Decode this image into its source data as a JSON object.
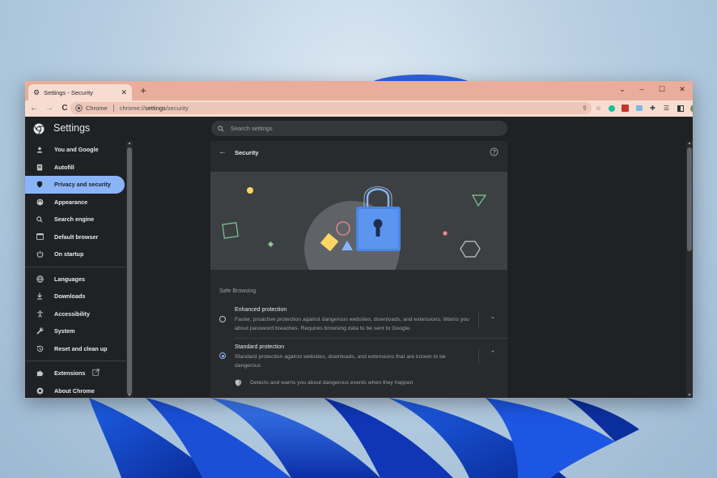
{
  "window": {
    "tab_title": "Settings - Security",
    "tab_close": "✕",
    "new_tab": "+",
    "controls": {
      "chevron": "⌄",
      "minimize": "–",
      "maximize": "☐",
      "close": "✕"
    }
  },
  "toolbar": {
    "back": "←",
    "forward": "→",
    "reload": "C",
    "site_name": "Chrome",
    "url_prefix": "chrome://",
    "url_host": "settings",
    "url_path": "/security"
  },
  "header": {
    "title": "Settings",
    "search_placeholder": "Search settings"
  },
  "sidebar": {
    "items": [
      {
        "label": "You and Google",
        "icon": "person-icon"
      },
      {
        "label": "Autofill",
        "icon": "clipboard-icon"
      },
      {
        "label": "Privacy and security",
        "icon": "shield-icon",
        "active": true
      },
      {
        "label": "Appearance",
        "icon": "palette-icon"
      },
      {
        "label": "Search engine",
        "icon": "search-icon"
      },
      {
        "label": "Default browser",
        "icon": "browser-icon"
      },
      {
        "label": "On startup",
        "icon": "power-icon"
      },
      {
        "label": "Languages",
        "icon": "globe-icon"
      },
      {
        "label": "Downloads",
        "icon": "download-icon"
      },
      {
        "label": "Accessibility",
        "icon": "accessibility-icon"
      },
      {
        "label": "System",
        "icon": "wrench-icon"
      },
      {
        "label": "Reset and clean up",
        "icon": "history-icon"
      },
      {
        "label": "Extensions",
        "icon": "puzzle-icon"
      },
      {
        "label": "About Chrome",
        "icon": "chrome-icon"
      }
    ]
  },
  "main": {
    "page_title": "Security",
    "section_heading": "Safe Browsing",
    "options": [
      {
        "title": "Enhanced protection",
        "description": "Faster, proactive protection against dangerous websites, downloads, and extensions. Warns you about password breaches. Requires browsing data to be sent to Google.",
        "selected": false
      },
      {
        "title": "Standard protection",
        "description": "Standard protection against websites, downloads, and extensions that are known to be dangerous",
        "selected": true
      }
    ],
    "detail_text": "Detects and warns you about dangerous events when they happen"
  },
  "colors": {
    "accent": "#8ab4f8",
    "tab_strip": "#e9ad9b",
    "toolbar": "#f7dcd2",
    "surface": "#292a2d",
    "background": "#202124"
  }
}
